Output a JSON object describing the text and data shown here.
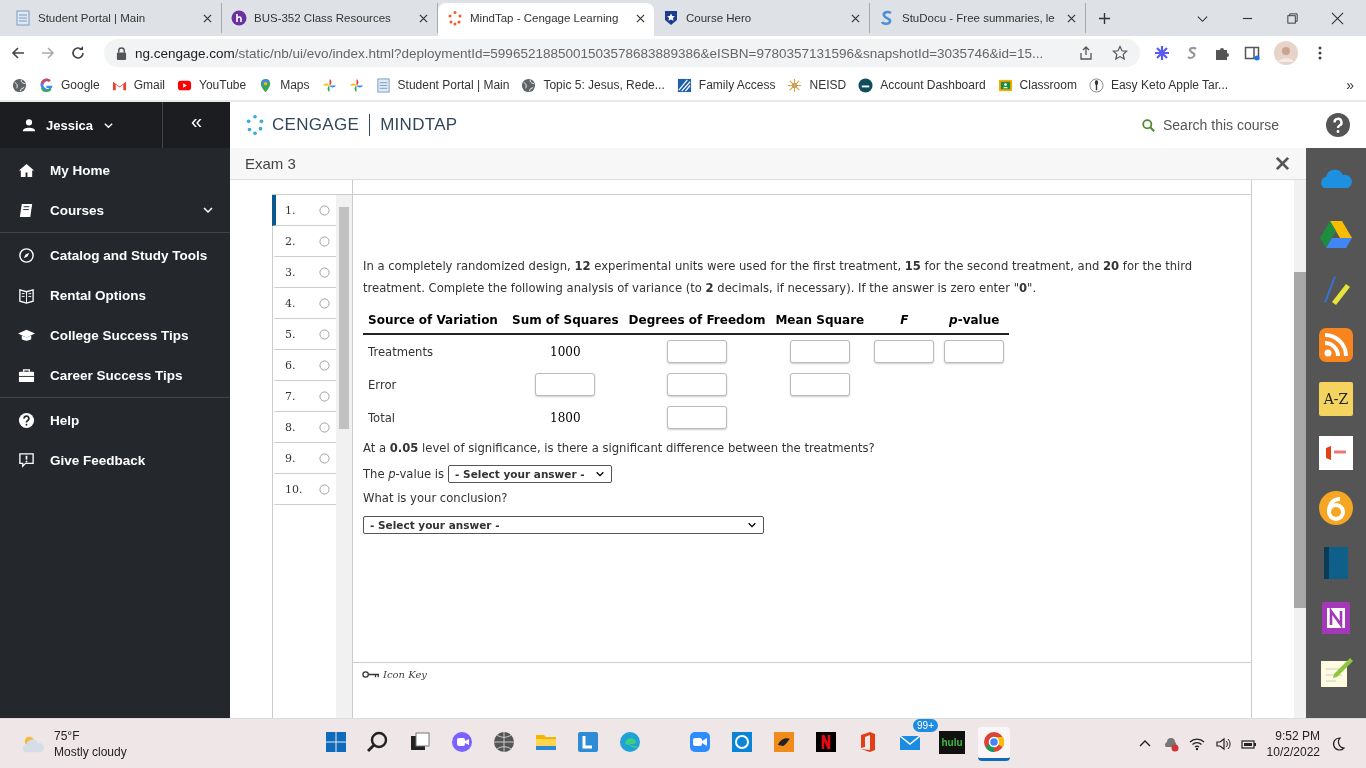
{
  "browser": {
    "tabs": [
      {
        "title": "Student Portal | Main",
        "selected": false
      },
      {
        "title": "BUS-352 Class Resources",
        "selected": false
      },
      {
        "title": "MindTap - Cengage Learning",
        "selected": true
      },
      {
        "title": "Course Hero",
        "selected": false
      },
      {
        "title": "StuDocu - Free summaries, le",
        "selected": false
      }
    ],
    "url_host": "ng.cengage.com",
    "url_path": "/static/nb/ui/evo/index.html?deploymentId=5996521885001503578683889386&eISBN=9780357131596&snapshotId=3035746&id=15...",
    "bookmarks": [
      {
        "kind": "icon"
      },
      {
        "kind": "link",
        "label": "Google"
      },
      {
        "kind": "link",
        "label": "Gmail"
      },
      {
        "kind": "link",
        "label": "YouTube"
      },
      {
        "kind": "link",
        "label": "Maps"
      },
      {
        "kind": "icon"
      },
      {
        "kind": "icon"
      },
      {
        "kind": "link",
        "label": "Student Portal | Main"
      },
      {
        "kind": "link",
        "label": "Topic 5: Jesus, Rede..."
      },
      {
        "kind": "link",
        "label": "Family Access"
      },
      {
        "kind": "link",
        "label": "NEISD"
      },
      {
        "kind": "link",
        "label": "Account Dashboard"
      },
      {
        "kind": "link",
        "label": "Classroom"
      },
      {
        "kind": "link",
        "label": "Easy Keto Apple Tar..."
      }
    ],
    "bookmarks_more": "»"
  },
  "sidebar": {
    "user": "Jessica",
    "collapse": "«",
    "groups": [
      [
        {
          "label": "My Home"
        },
        {
          "label": "Courses",
          "expanded": false
        }
      ],
      [
        {
          "label": "Catalog and Study Tools"
        },
        {
          "label": "Rental Options"
        },
        {
          "label": "College Success Tips"
        },
        {
          "label": "Career Success Tips"
        }
      ],
      [
        {
          "label": "Help"
        },
        {
          "label": "Give Feedback"
        }
      ]
    ]
  },
  "header": {
    "brand": "CENGAGE",
    "product": "MINDTAP",
    "search_placeholder": "Search this course"
  },
  "exam": {
    "title": "Exam 3"
  },
  "questions": [
    {
      "number": "1.",
      "selected": true,
      "answered": false
    },
    {
      "number": "2.",
      "selected": false,
      "answered": false
    },
    {
      "number": "3.",
      "selected": false,
      "answered": false
    },
    {
      "number": "4.",
      "selected": false,
      "answered": false
    },
    {
      "number": "5.",
      "selected": false,
      "answered": false
    },
    {
      "number": "6.",
      "selected": false,
      "answered": false
    },
    {
      "number": "7.",
      "selected": false,
      "answered": false
    },
    {
      "number": "8.",
      "selected": false,
      "answered": false
    },
    {
      "number": "9.",
      "selected": false,
      "answered": false
    },
    {
      "number": "10.",
      "selected": false,
      "answered": false
    }
  ],
  "problem": {
    "prompt": "In a completely randomized design, **12** experimental units were used for the first treatment, **15** for the second treatment, and **20** for the third treatment. Complete the following analysis of variance (to **2** decimals, if necessary). If the answer is zero enter \"**0**\".",
    "table": {
      "columns": [
        "Source of Variation",
        "Sum of Squares",
        "Degrees of Freedom",
        "Mean Square",
        "*F*",
        "*p*-value"
      ],
      "rows": [
        {
          "source": "Treatments",
          "cells": [
            {
              "kind": "text",
              "value": "1000"
            },
            {
              "kind": "input"
            },
            {
              "kind": "input"
            },
            {
              "kind": "input"
            },
            {
              "kind": "input"
            }
          ]
        },
        {
          "source": "Error",
          "cells": [
            {
              "kind": "input"
            },
            {
              "kind": "input"
            },
            {
              "kind": "input"
            },
            {
              "kind": "empty"
            },
            {
              "kind": "empty"
            }
          ]
        },
        {
          "source": "Total",
          "cells": [
            {
              "kind": "text",
              "value": "1800"
            },
            {
              "kind": "input"
            },
            {
              "kind": "empty"
            },
            {
              "kind": "empty"
            },
            {
              "kind": "empty"
            }
          ]
        }
      ]
    },
    "significance_question": "At a **0.05** level of significance, is there a significant difference between the treatments?",
    "pvalue_label": "The *p*-value is",
    "pvalue_select": "- Select your answer -",
    "conclusion_label": "What is your conclusion?",
    "conclusion_select": "- Select your answer -",
    "icon_key": "Icon Key"
  },
  "rail": {
    "az_label": "A-Z"
  },
  "taskbar": {
    "temperature": "75°F",
    "weather": "Mostly cloudy",
    "apps": [
      {
        "kind": "windows",
        "active": false
      },
      {
        "kind": "search",
        "active": false
      },
      {
        "kind": "taskview",
        "active": false
      },
      {
        "kind": "chat",
        "active": false
      },
      {
        "kind": "globe",
        "active": false
      },
      {
        "kind": "folder",
        "active": false
      },
      {
        "kind": "lapp",
        "active": false
      },
      {
        "kind": "edge",
        "active": false
      },
      {
        "kind": "zoom",
        "active": false
      },
      {
        "kind": "cortana",
        "active": false
      },
      {
        "kind": "orange",
        "active": false
      },
      {
        "kind": "netflix",
        "active": false
      },
      {
        "kind": "office",
        "active": false
      },
      {
        "kind": "mail",
        "badge": "99+",
        "active": false
      },
      {
        "kind": "hulu",
        "label": "hulu",
        "active": false
      },
      {
        "kind": "chrome",
        "active": true
      }
    ],
    "time": "9:52 PM",
    "date": "10/2/2022"
  }
}
